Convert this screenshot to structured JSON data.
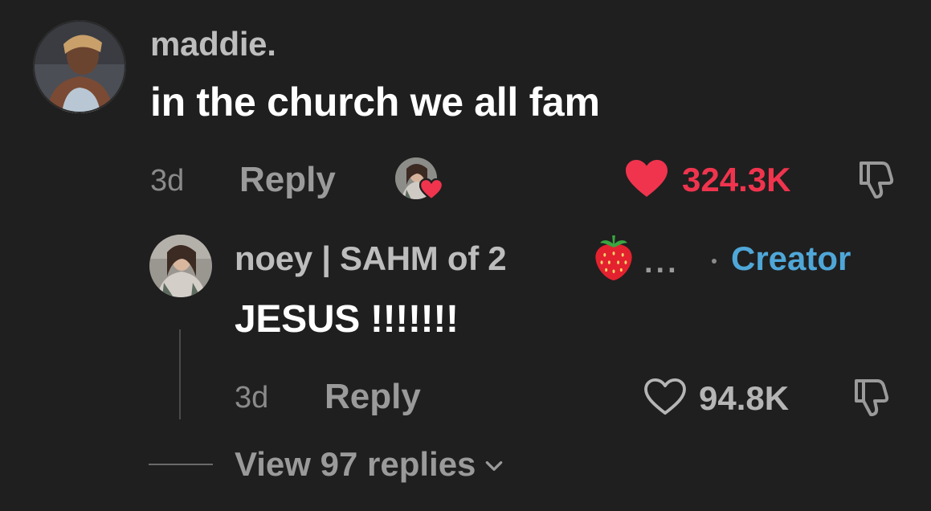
{
  "comment": {
    "username": "maddie.",
    "text": "in the church we all fam",
    "time": "3d",
    "reply_label": "Reply",
    "likes": "324.3K",
    "liked": true,
    "creator_liked": true
  },
  "reply": {
    "username": "noey | SAHM of 2",
    "username_emoji": "strawberry",
    "truncation": "...",
    "badge": "Creator",
    "text": "JESUS !!!!!!!",
    "time": "3d",
    "reply_label": "Reply",
    "likes": "94.8K",
    "liked": false
  },
  "view_replies": {
    "label": "View 97 replies"
  },
  "colors": {
    "background": "#1f1f1f",
    "liked_red": "#f0344e",
    "creator_blue": "#4fa7d8",
    "muted_gray": "#9a9a9a",
    "text_white": "#ffffff"
  },
  "icons": {
    "like_filled": "heart-filled-icon",
    "like_outline": "heart-outline-icon",
    "dislike": "thumbs-down-icon",
    "chevron": "chevron-down-icon"
  }
}
